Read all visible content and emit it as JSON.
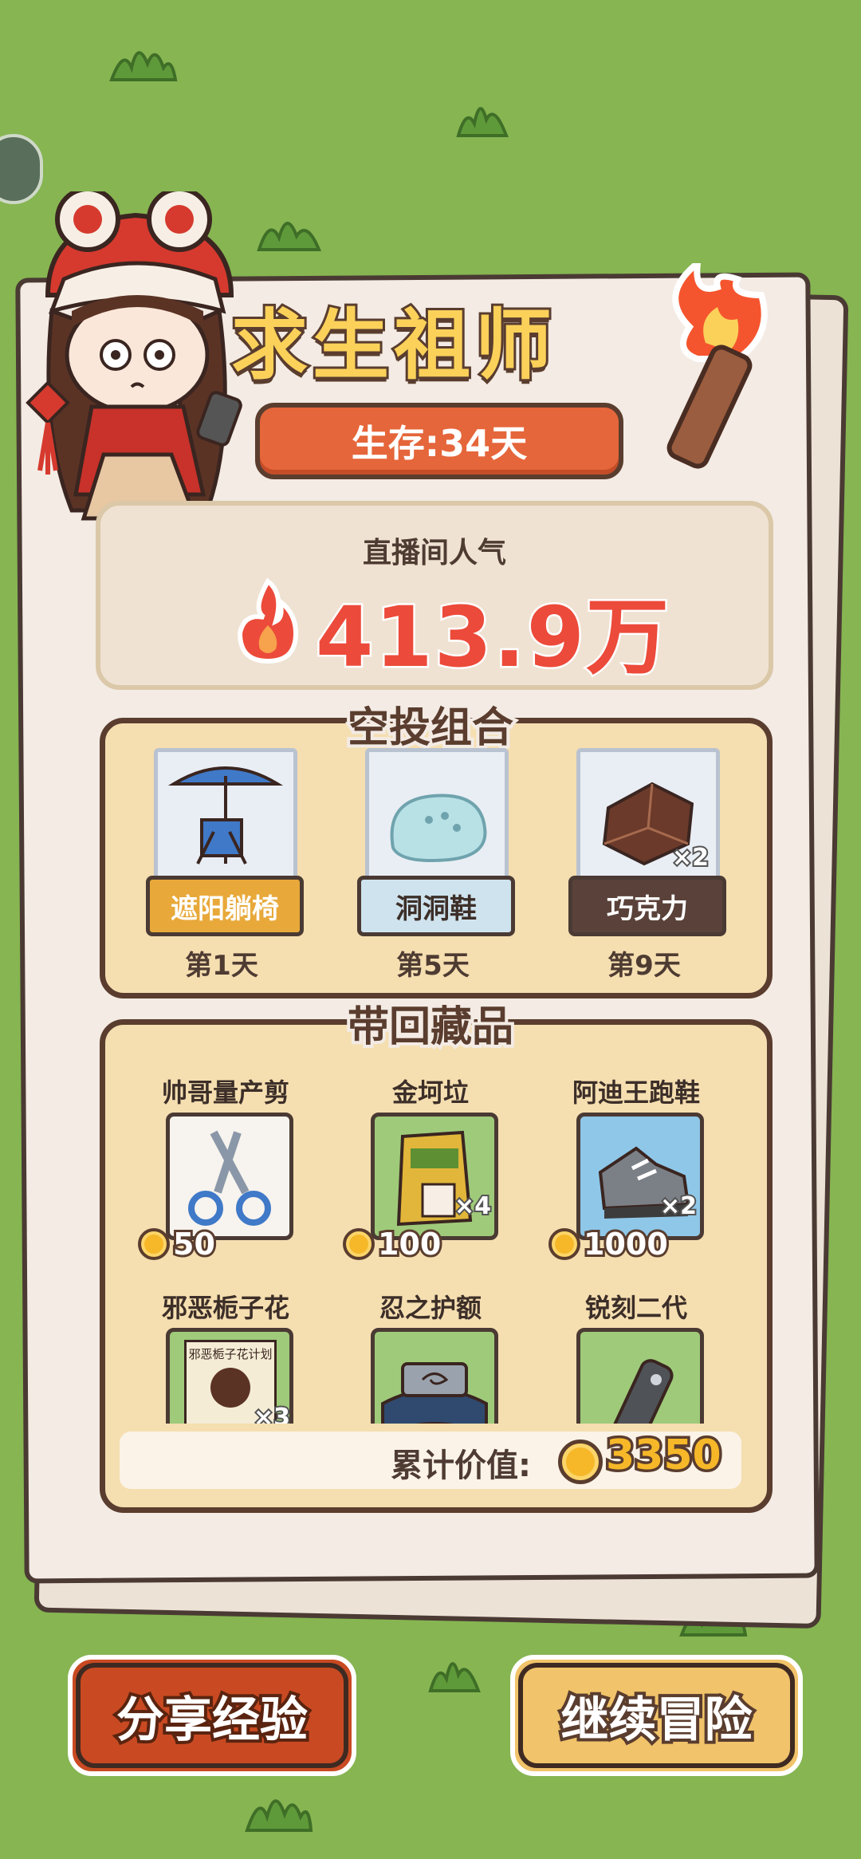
{
  "header": {
    "title": "求生祖师",
    "survival": "生存:34天"
  },
  "popularity": {
    "label": "直播间人气",
    "value": "413.9万"
  },
  "airdrop": {
    "title": "空投组合",
    "items": [
      {
        "name": "遮阳躺椅",
        "day": "第1天",
        "qty": "",
        "tag_color": "#e8a93a"
      },
      {
        "name": "洞洞鞋",
        "day": "第5天",
        "qty": "",
        "tag_color": "#cfe3ee"
      },
      {
        "name": "巧克力",
        "day": "第9天",
        "qty": "×2",
        "tag_color": "#5a423a"
      }
    ]
  },
  "collection": {
    "title": "带回藏品",
    "items": [
      {
        "name": "帅哥量产剪",
        "price": "50",
        "qty": ""
      },
      {
        "name": "金坷垃",
        "price": "100",
        "qty": "×4"
      },
      {
        "name": "阿迪王跑鞋",
        "price": "1000",
        "qty": "×2"
      },
      {
        "name": "邪恶栀子花",
        "price": "",
        "qty": "×3",
        "poster_text": "邪恶栀子花计划"
      },
      {
        "name": "忍之护额",
        "price": "",
        "qty": ""
      },
      {
        "name": "锐刻二代",
        "price": "",
        "qty": ""
      }
    ],
    "total_label": "累计价值:",
    "total_value": "3350"
  },
  "buttons": {
    "share": "分享经验",
    "continue": "继续冒险"
  },
  "colors": {
    "background": "#86b552",
    "accent_orange": "#e5663a",
    "title_yellow": "#fbd15a",
    "popularity_red": "#ec4a3a",
    "coin_gold": "#f6b829"
  }
}
